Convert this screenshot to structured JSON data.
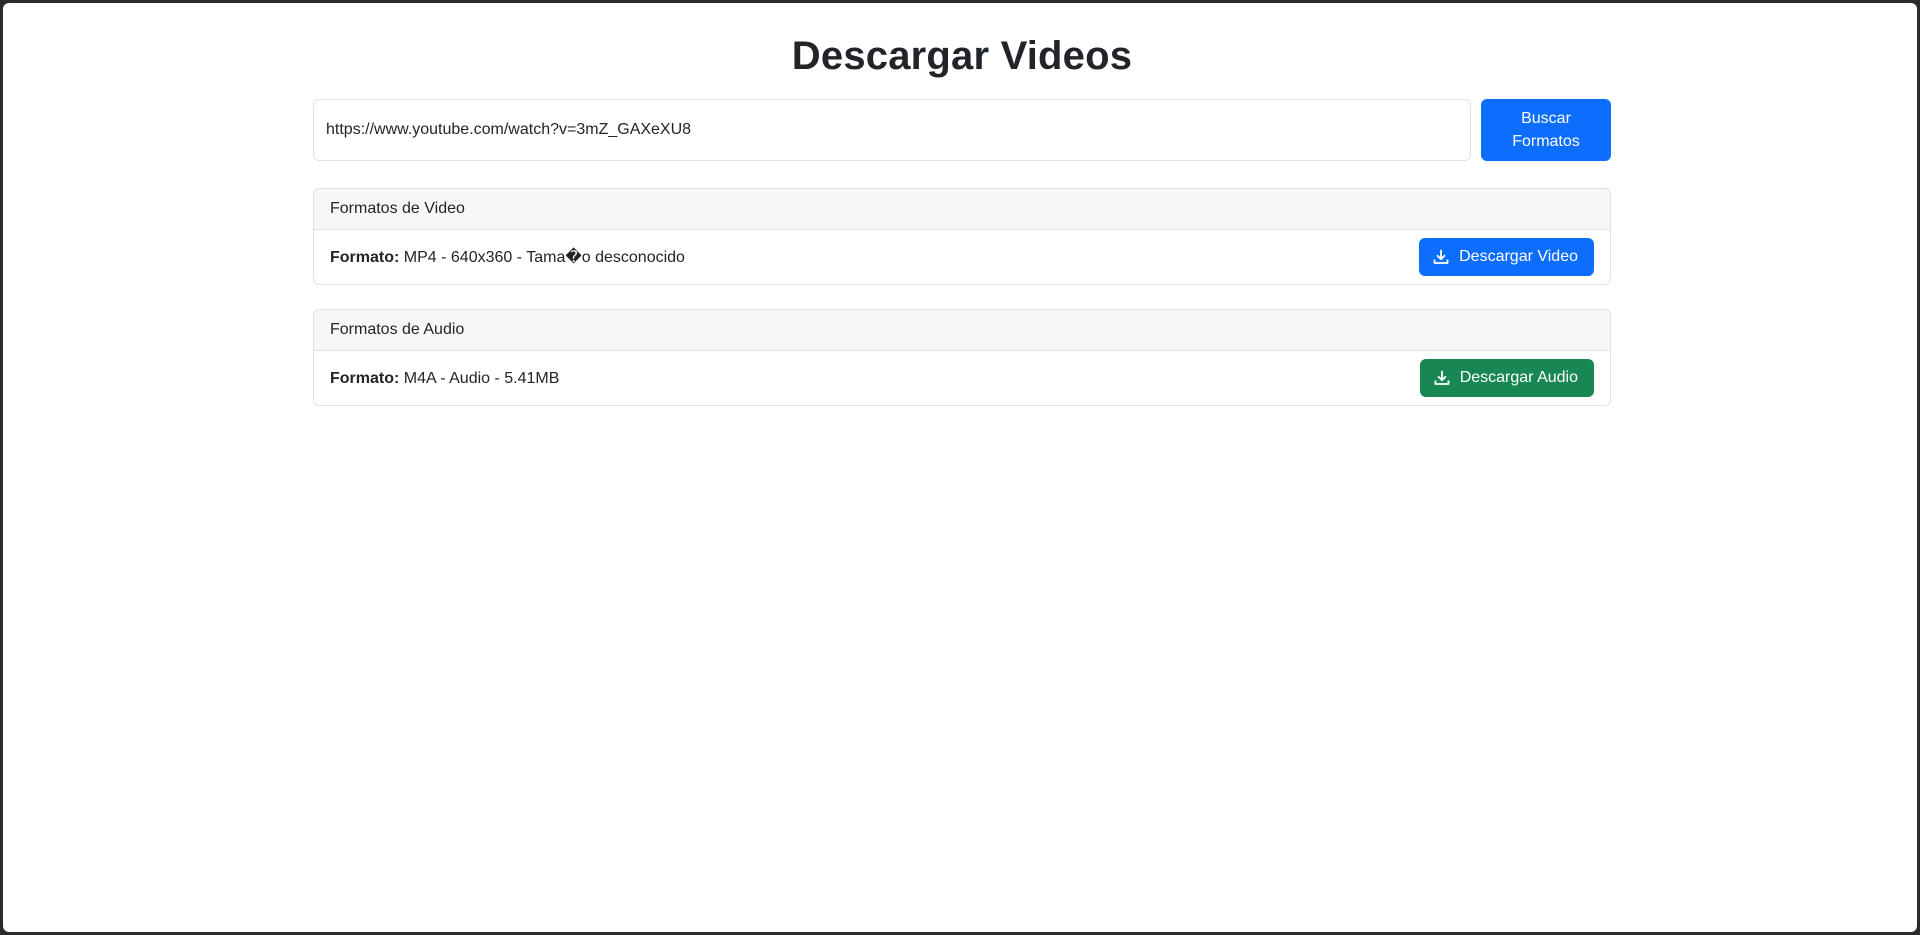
{
  "page": {
    "title": "Descargar Videos"
  },
  "search": {
    "url_value": "https://www.youtube.com/watch?v=3mZ_GAXeXU8",
    "button_label": "Buscar Formatos"
  },
  "video_section": {
    "header": "Formatos de Video",
    "format_label": "Formato:",
    "format_value": "MP4 - 640x360 - Tama�o desconocido",
    "button_label": "Descargar Video",
    "button_icon": "download-icon"
  },
  "audio_section": {
    "header": "Formatos de Audio",
    "format_label": "Formato:",
    "format_value": "M4A - Audio - 5.41MB",
    "button_label": "Descargar Audio",
    "button_icon": "download-icon"
  },
  "colors": {
    "primary": "#0d6efd",
    "success": "#198754"
  }
}
